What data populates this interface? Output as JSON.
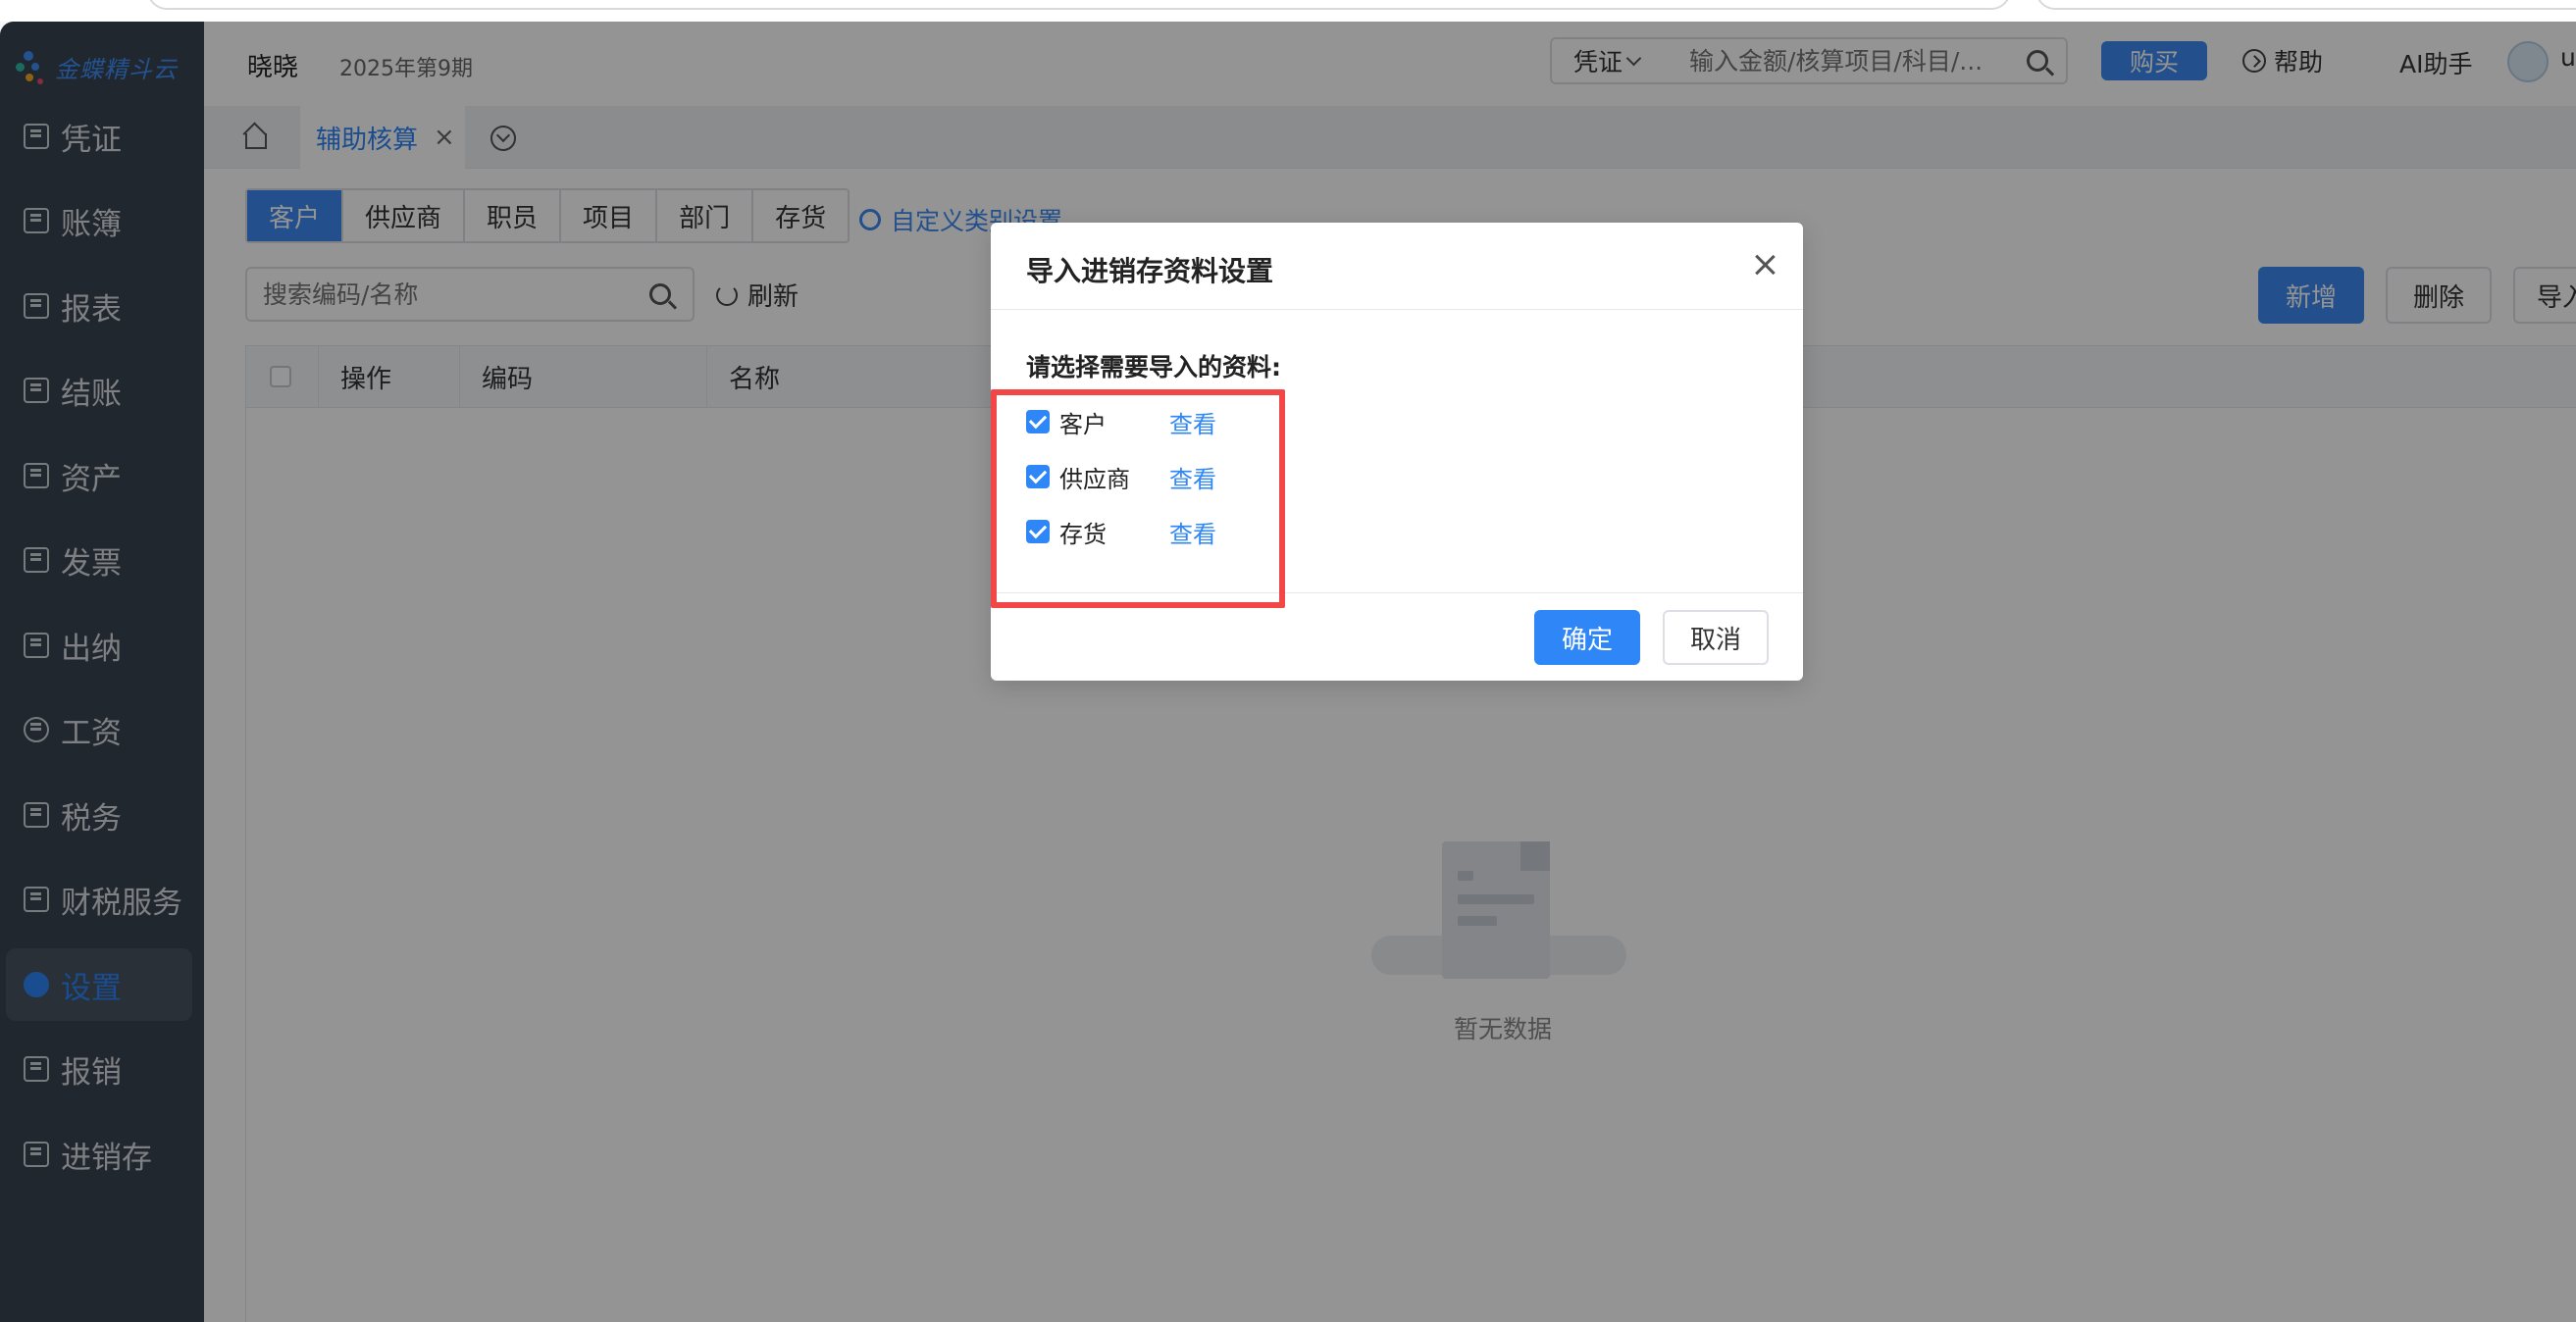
{
  "brand": {
    "logo_text": "金蝶精斗云"
  },
  "sidebar": {
    "items": [
      {
        "label": "凭证",
        "icon": "voucher-icon"
      },
      {
        "label": "账簿",
        "icon": "ledger-icon"
      },
      {
        "label": "报表",
        "icon": "report-icon"
      },
      {
        "label": "结账",
        "icon": "closing-icon"
      },
      {
        "label": "资产",
        "icon": "asset-icon"
      },
      {
        "label": "发票",
        "icon": "invoice-icon"
      },
      {
        "label": "出纳",
        "icon": "cashier-icon"
      },
      {
        "label": "工资",
        "icon": "yen-icon"
      },
      {
        "label": "税务",
        "icon": "tax-icon"
      },
      {
        "label": "财税服务",
        "icon": "service-icon"
      },
      {
        "label": "设置",
        "icon": "gear-icon",
        "active": true
      },
      {
        "label": "报销",
        "icon": "reimburse-icon"
      },
      {
        "label": "进销存",
        "icon": "inventory-icon"
      }
    ]
  },
  "header": {
    "company": "晓晓",
    "period": "2025年第9期",
    "search_type": "凭证",
    "search_placeholder": "输入金额/核算项目/科目/...",
    "buy_label": "购买",
    "help_label": "帮助",
    "ai_label": "AI助手",
    "user_initial": "u"
  },
  "tabs": {
    "active_tab": "辅助核算",
    "close_glyph": "×"
  },
  "content": {
    "subtabs": [
      "客户",
      "供应商",
      "职员",
      "项目",
      "部门",
      "存货"
    ],
    "custom_category_link": "自定义类别设置",
    "search_placeholder": "搜索编码/名称",
    "refresh_label": "刷新",
    "add_label": "新增",
    "delete_label": "删除",
    "import_label": "导入",
    "columns": [
      "操作",
      "编码",
      "名称"
    ],
    "empty_text": "暂无数据"
  },
  "modal": {
    "title": "导入进销存资料设置",
    "prompt": "请选择需要导入的资料:",
    "options": [
      {
        "label": "客户",
        "link": "查看",
        "checked": true
      },
      {
        "label": "供应商",
        "link": "查看",
        "checked": true
      },
      {
        "label": "存货",
        "link": "查看",
        "checked": true
      }
    ],
    "confirm_label": "确定",
    "cancel_label": "取消"
  },
  "colors": {
    "accent": "#2e86f7",
    "sidebar_bg": "#394450",
    "highlight": "#f24747"
  }
}
